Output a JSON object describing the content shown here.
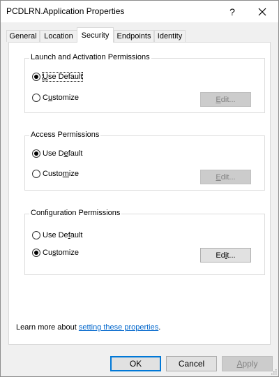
{
  "window": {
    "title": "PCDLRN.Application Properties",
    "help_glyph": "?",
    "close_glyph": "✕"
  },
  "tabs": [
    {
      "label": "General",
      "active": false
    },
    {
      "label": "Location",
      "active": false
    },
    {
      "label": "Security",
      "active": true
    },
    {
      "label": "Endpoints",
      "active": false
    },
    {
      "label": "Identity",
      "active": false
    }
  ],
  "groups": {
    "launch": {
      "legend": "Launch and Activation Permissions",
      "use_default": {
        "pre": "",
        "key": "U",
        "post": "se Default",
        "checked": true
      },
      "customize": {
        "pre": "C",
        "key": "u",
        "post": "stomize",
        "checked": false
      },
      "edit": {
        "key": "E",
        "post": "dit...",
        "enabled": false
      }
    },
    "access": {
      "legend": "Access Permissions",
      "use_default": {
        "pre": "Use D",
        "key": "e",
        "post": "fault",
        "checked": true
      },
      "customize": {
        "pre": "Custo",
        "key": "m",
        "post": "ize",
        "checked": false
      },
      "edit": {
        "key": "E",
        "post": "dit...",
        "enabled": false
      }
    },
    "config": {
      "legend": "Configuration Permissions",
      "use_default": {
        "pre": "Use De",
        "key": "f",
        "post": "ault",
        "checked": false
      },
      "customize": {
        "pre": "Cu",
        "key": "s",
        "post": "tomize",
        "checked": true
      },
      "edit": {
        "pre": "Ed",
        "key": "i",
        "post": "t...",
        "enabled": true
      }
    }
  },
  "learn_more": {
    "prefix": "Learn more about ",
    "link": "setting these properties",
    "suffix": "."
  },
  "buttons": {
    "ok": "OK",
    "cancel": "Cancel",
    "apply": {
      "key": "A",
      "post": "pply",
      "enabled": false
    }
  },
  "colors": {
    "link": "#0066cc",
    "default_button_border": "#0078d7",
    "disabled_text": "#838383"
  }
}
